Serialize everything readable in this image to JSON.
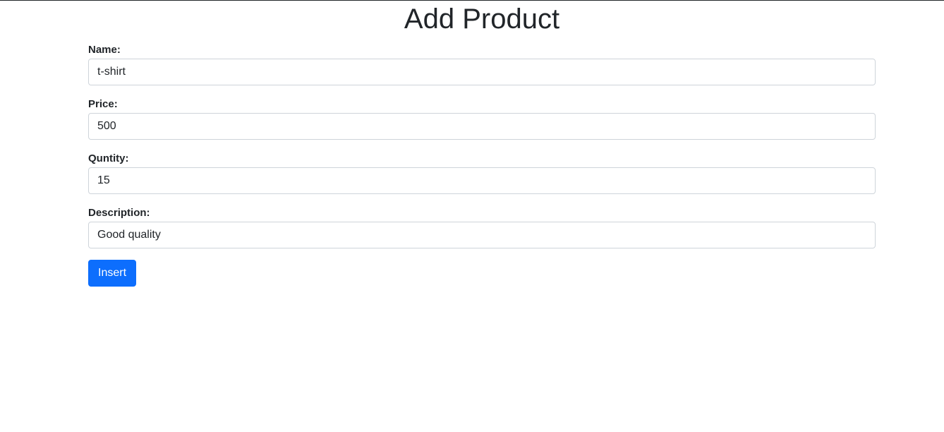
{
  "page": {
    "title": "Add Product"
  },
  "form": {
    "name": {
      "label": "Name:",
      "value": "t-shirt"
    },
    "price": {
      "label": "Price:",
      "value": "500"
    },
    "quantity": {
      "label": "Quntity:",
      "value": "15"
    },
    "description": {
      "label": "Description:",
      "value": "Good quality"
    },
    "submit_label": "Insert"
  },
  "colors": {
    "primary": "#0d6efd",
    "text": "#212529",
    "input_border": "#ced4da"
  }
}
